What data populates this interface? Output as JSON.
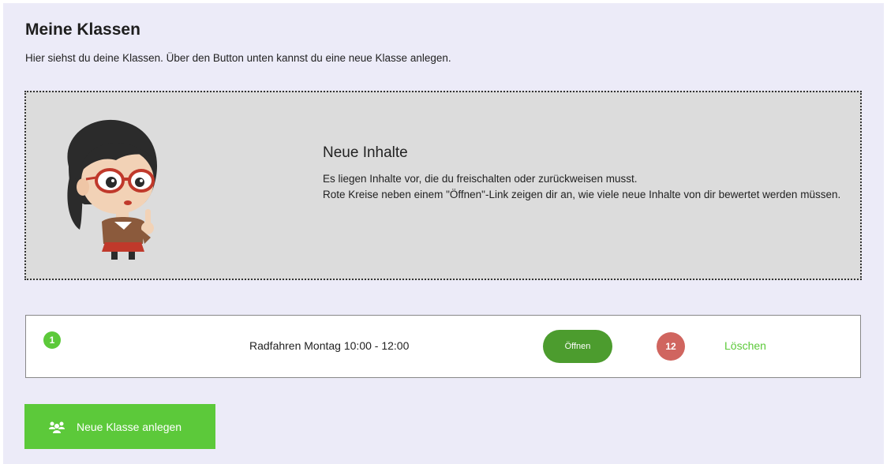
{
  "page": {
    "title": "Meine Klassen",
    "description": "Hier siehst du deine Klassen. Über den Button unten kannst du eine neue Klasse anlegen."
  },
  "info": {
    "title": "Neue Inhalte",
    "line1": "Es liegen Inhalte vor, die du freischalten oder zurückweisen musst.",
    "line2": "Rote Kreise neben einem \"Öffnen\"-Link zeigen dir an, wie viele neue Inhalte von dir bewertet werden müssen.",
    "illustration": "teacher-illustration"
  },
  "classes": [
    {
      "number": "1",
      "name": "Radfahren Montag 10:00 - 12:00",
      "open_label": "Öffnen",
      "new_count": "12",
      "delete_label": "Löschen"
    }
  ],
  "actions": {
    "new_class_label": "Neue Klasse anlegen",
    "new_class_icon": "group-icon"
  },
  "colors": {
    "background": "#ecebf8",
    "green": "#5cc93a",
    "dark_green": "#4c9c2e",
    "red_badge": "#d0655f",
    "info_box": "#dcdcdc"
  }
}
